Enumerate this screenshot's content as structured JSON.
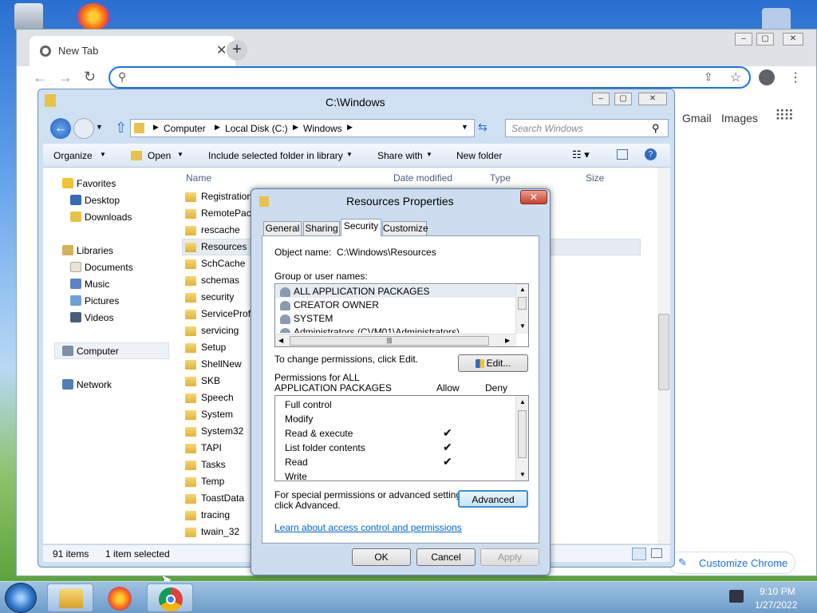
{
  "chrome": {
    "tab_title": "New Tab",
    "address_value": "",
    "links": {
      "gmail": "Gmail",
      "images": "Images"
    },
    "customize": "Customize Chrome"
  },
  "explorer": {
    "title": "C:\\Windows",
    "breadcrumb": [
      "Computer",
      "Local Disk (C:)",
      "Windows"
    ],
    "search_placeholder": "Search Windows",
    "toolbar": {
      "organize": "Organize",
      "open": "Open",
      "include": "Include selected folder in library",
      "share": "Share with",
      "new_folder": "New folder"
    },
    "columns": {
      "name": "Name",
      "date": "Date modified",
      "type": "Type",
      "size": "Size"
    },
    "nav": {
      "favorites": "Favorites",
      "desktop": "Desktop",
      "downloads": "Downloads",
      "libraries": "Libraries",
      "documents": "Documents",
      "music": "Music",
      "pictures": "Pictures",
      "videos": "Videos",
      "computer": "Computer",
      "network": "Network"
    },
    "files": [
      "Registration",
      "RemotePac",
      "rescache",
      "Resources",
      "SchCache",
      "schemas",
      "security",
      "ServiceProfi",
      "servicing",
      "Setup",
      "ShellNew",
      "SKB",
      "Speech",
      "System",
      "System32",
      "TAPI",
      "Tasks",
      "Temp",
      "ToastData",
      "tracing",
      "twain_32"
    ],
    "status": {
      "count": "91 items",
      "selected": "1 item selected"
    }
  },
  "dialog": {
    "title": "Resources Properties",
    "tabs": [
      "General",
      "Sharing",
      "Security",
      "Customize"
    ],
    "object_label": "Object name:",
    "object_value": "C:\\Windows\\Resources",
    "group_label": "Group or user names:",
    "users": [
      "ALL APPLICATION PACKAGES",
      "CREATOR OWNER",
      "SYSTEM",
      "Administrators (CVM01\\Administrators)"
    ],
    "change_text": "To change permissions, click Edit.",
    "edit_btn": "Edit...",
    "perm_header1": "Permissions for ALL",
    "perm_header2": "APPLICATION PACKAGES",
    "allow": "Allow",
    "deny": "Deny",
    "permissions": [
      "Full control",
      "Modify",
      "Read & execute",
      "List folder contents",
      "Read",
      "Write"
    ],
    "special1": "For special permissions or advanced settings,",
    "special2": "click Advanced.",
    "advanced_btn": "Advanced",
    "learn_link": "Learn about access control and permissions",
    "ok": "OK",
    "cancel": "Cancel",
    "apply": "Apply"
  },
  "taskbar": {
    "time": "9:10 PM",
    "date": "1/27/2022"
  }
}
